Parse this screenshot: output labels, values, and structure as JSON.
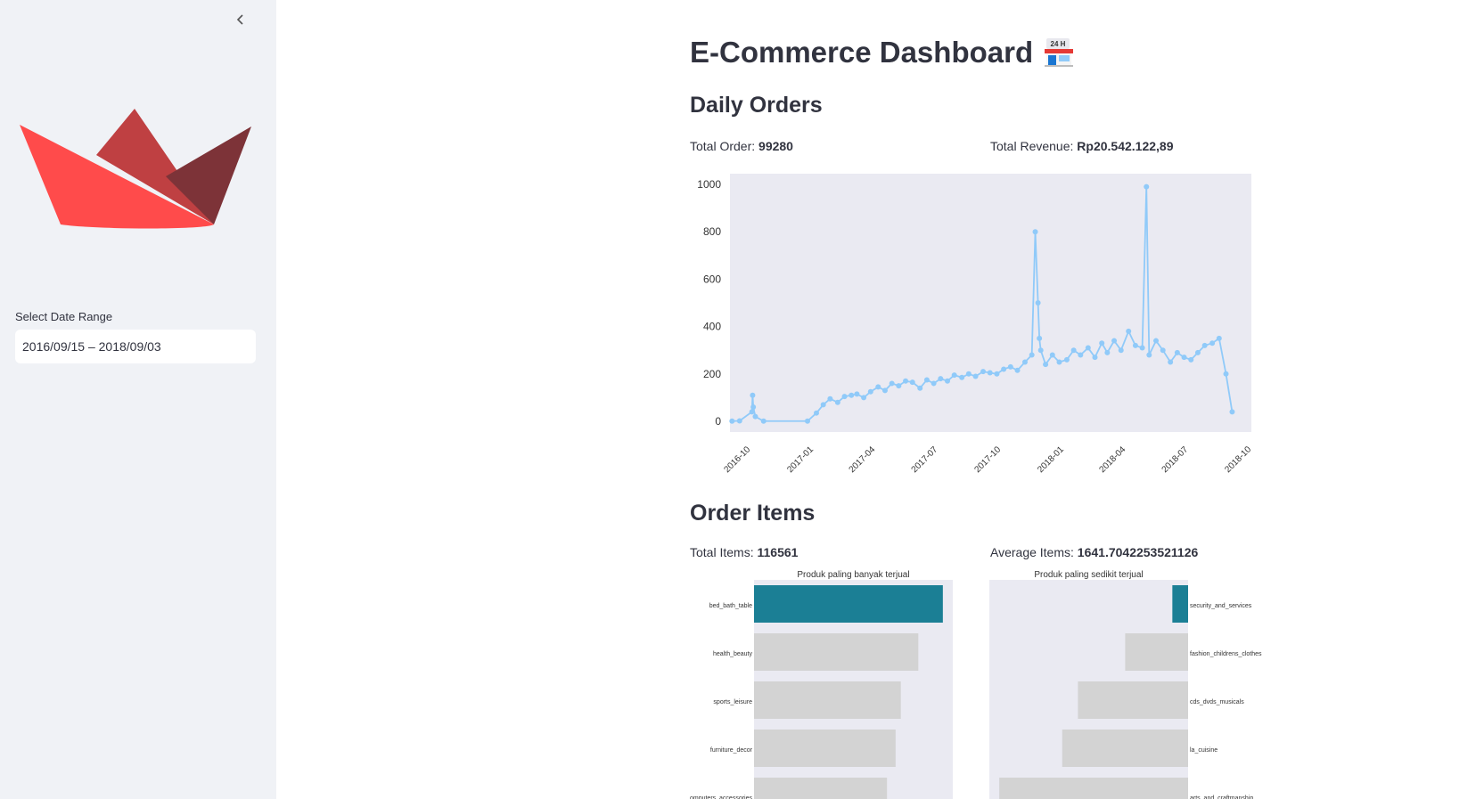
{
  "sidebar": {
    "date_label": "Select Date Range",
    "date_value": "2016/09/15 – 2018/09/03",
    "colors": {
      "boat_light": "#ff4b4b",
      "boat_mid": "#bf4042",
      "boat_dark": "#7d3338"
    }
  },
  "main": {
    "title": "E-Commerce Dashboard",
    "title_icon": "convenience-store-icon",
    "title_icon_text": "24 H",
    "daily": {
      "heading": "Daily Orders",
      "total_order_label": "Total Order:",
      "total_order_value": "99280",
      "total_revenue_label": "Total Revenue:",
      "total_revenue_value": "Rp20.542.122,89"
    },
    "items": {
      "heading": "Order Items",
      "total_items_label": "Total Items:",
      "total_items_value": "116561",
      "average_items_label": "Average Items:",
      "average_items_value": "1641.7042253521126"
    }
  },
  "chart_data": [
    {
      "type": "line",
      "title": "",
      "xlabel": "",
      "ylabel": "",
      "color": "#90caf9",
      "background": "#eaeaf2",
      "x_ticks": [
        "2016-10",
        "2017-01",
        "2017-04",
        "2017-07",
        "2017-10",
        "2018-01",
        "2018-04",
        "2018-07",
        "2018-10"
      ],
      "y_ticks": [
        0,
        200,
        400,
        600,
        800,
        1000
      ],
      "ylim": [
        0,
        1000
      ],
      "xlim": [
        "2016-09-01",
        "2018-10-01"
      ],
      "series": [
        {
          "x": [
            "2016-09-04",
            "2016-09-15",
            "2016-10-03",
            "2016-10-04",
            "2016-10-05",
            "2016-10-08",
            "2016-10-20",
            "2016-12-23",
            "2017-01-05",
            "2017-01-15",
            "2017-01-25",
            "2017-02-05",
            "2017-02-15",
            "2017-02-25",
            "2017-03-05",
            "2017-03-15",
            "2017-03-25",
            "2017-04-05",
            "2017-04-15",
            "2017-04-25",
            "2017-05-05",
            "2017-05-15",
            "2017-05-25",
            "2017-06-05",
            "2017-06-15",
            "2017-06-25",
            "2017-07-05",
            "2017-07-15",
            "2017-07-25",
            "2017-08-05",
            "2017-08-15",
            "2017-08-25",
            "2017-09-05",
            "2017-09-15",
            "2017-09-25",
            "2017-10-05",
            "2017-10-15",
            "2017-10-25",
            "2017-11-05",
            "2017-11-15",
            "2017-11-20",
            "2017-11-24",
            "2017-11-26",
            "2017-11-28",
            "2017-12-05",
            "2017-12-15",
            "2017-12-25",
            "2018-01-05",
            "2018-01-15",
            "2018-01-25",
            "2018-02-05",
            "2018-02-15",
            "2018-02-25",
            "2018-03-05",
            "2018-03-15",
            "2018-03-25",
            "2018-04-05",
            "2018-04-15",
            "2018-04-25",
            "2018-05-01",
            "2018-05-05",
            "2018-05-15",
            "2018-05-25",
            "2018-06-05",
            "2018-06-15",
            "2018-06-25",
            "2018-07-05",
            "2018-07-15",
            "2018-07-25",
            "2018-08-05",
            "2018-08-15",
            "2018-08-25",
            "2018-09-03"
          ],
          "y": [
            1,
            2,
            40,
            110,
            60,
            20,
            1,
            1,
            35,
            70,
            95,
            80,
            105,
            110,
            115,
            100,
            125,
            145,
            130,
            160,
            150,
            170,
            165,
            140,
            175,
            160,
            180,
            170,
            195,
            185,
            200,
            190,
            210,
            205,
            200,
            220,
            230,
            215,
            250,
            280,
            800,
            500,
            350,
            300,
            240,
            280,
            250,
            260,
            300,
            280,
            310,
            270,
            330,
            290,
            340,
            300,
            380,
            320,
            310,
            990,
            280,
            340,
            300,
            250,
            290,
            270,
            260,
            290,
            320,
            330,
            350,
            200,
            40
          ]
        }
      ]
    },
    {
      "type": "bar",
      "orientation": "horizontal",
      "title": "Produk paling banyak terjual",
      "categories": [
        "bed_bath_table",
        "health_beauty",
        "sports_leisure",
        "furniture_decor",
        "computers_accessories"
      ],
      "values": [
        11115,
        9670,
        8641,
        8334,
        7827
      ],
      "colors": [
        "#1b7f95",
        "#d3d3d3",
        "#d3d3d3",
        "#d3d3d3",
        "#d3d3d3"
      ],
      "background": "#eaeaf2"
    },
    {
      "type": "bar",
      "orientation": "horizontal",
      "title": "Produk paling sedikit terjual",
      "categories": [
        "security_and_services",
        "fashion_childrens_clothes",
        "cds_dvds_musicals",
        "la_cuisine",
        "arts_and_craftmanship"
      ],
      "values": [
        2,
        8,
        14,
        16,
        24
      ],
      "colors": [
        "#1b7f95",
        "#d3d3d3",
        "#d3d3d3",
        "#d3d3d3",
        "#d3d3d3"
      ],
      "background": "#eaeaf2"
    }
  ]
}
